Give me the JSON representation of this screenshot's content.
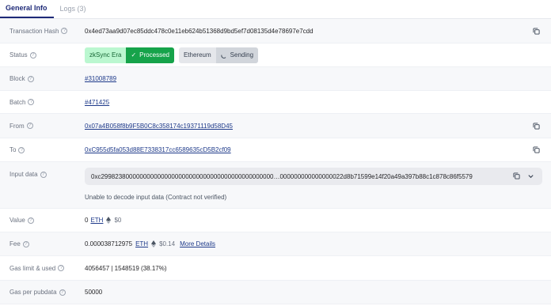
{
  "tabs": [
    {
      "label": "General Info"
    },
    {
      "label": "Logs (3)"
    }
  ],
  "rows": {
    "hash": {
      "label": "Transaction Hash",
      "value": "0x4ed73aa9d07ec85ddc478c0e11eb624b51368d9bd5ef7d08135d4e78697e7cdd"
    },
    "status": {
      "label": "Status",
      "zk_network": "zkSync Era",
      "zk_status": "Processed",
      "eth_network": "Ethereum",
      "eth_status": "Sending"
    },
    "block": {
      "label": "Block",
      "value": "#31008789"
    },
    "batch": {
      "label": "Batch",
      "value": "#471425"
    },
    "from": {
      "label": "From",
      "value": "0x07a4B058f8b9F5B0C8c358174c19371119d58D45"
    },
    "to": {
      "label": "To",
      "value": "0xC955d5fa053d88E7338317cc6589635cD5B2cf09"
    },
    "input": {
      "label": "Input data",
      "value": "0xc2998238000000000000000000000000000000000000000000…000000000000000022d8b71599e14f20a49a397b88c1c878c86f5579",
      "note": "Unable to decode input data (Contract not verified)"
    },
    "value": {
      "label": "Value",
      "amount": "0",
      "token": "ETH",
      "usd": "$0"
    },
    "fee": {
      "label": "Fee",
      "amount": "0.000038712975",
      "token": "ETH",
      "usd": "$0.14",
      "more": "More Details"
    },
    "gas": {
      "label": "Gas limit & used",
      "value": "4056457 | 1548519 (38.17%)"
    },
    "pubdata": {
      "label": "Gas per pubdata",
      "value": "50000"
    }
  },
  "icons": {
    "help": "?",
    "check": "✓"
  },
  "colors": {
    "processed": "#16a34a",
    "zksync_bg": "#bbf7d0",
    "tab_active": "#1e2a78"
  }
}
